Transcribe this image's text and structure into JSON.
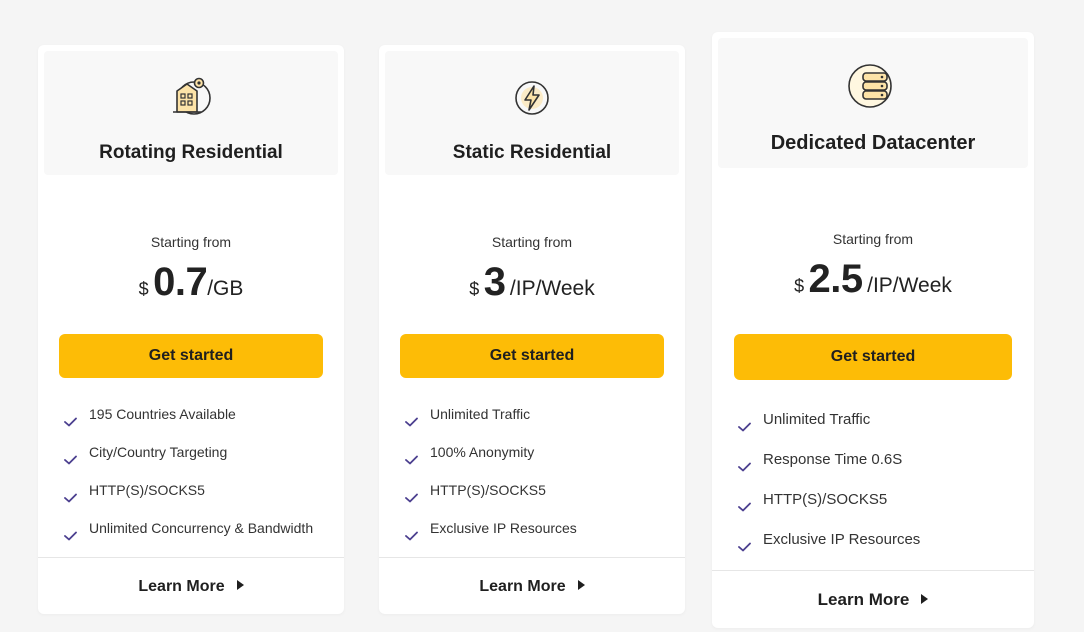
{
  "colors": {
    "accent": "#fdbc06",
    "check": "#4b3f8f",
    "icon_fill": "#fde3a7"
  },
  "cards": [
    {
      "icon": "residential-building-location-icon",
      "title": "Rotating Residential",
      "starting_label": "Starting from",
      "currency": "$",
      "price": "0.7",
      "unit": "/GB",
      "button_label": "Get started",
      "features": [
        "195 Countries Available",
        "City/Country Targeting",
        "HTTP(S)/SOCKS5",
        "Unlimited Concurrency & Bandwidth"
      ],
      "learn_more": "Learn More"
    },
    {
      "icon": "lightning-bolt-icon",
      "title": "Static Residential",
      "starting_label": "Starting from",
      "currency": "$",
      "price": "3",
      "unit": "/IP/Week",
      "button_label": "Get started",
      "features": [
        "Unlimited Traffic",
        "100% Anonymity",
        "HTTP(S)/SOCKS5",
        "Exclusive IP Resources"
      ],
      "learn_more": "Learn More"
    },
    {
      "icon": "server-stack-icon",
      "title": "Dedicated Datacenter",
      "starting_label": "Starting from",
      "currency": "$",
      "price": "2.5",
      "unit": "/IP/Week",
      "button_label": "Get started",
      "features": [
        "Unlimited Traffic",
        "Response Time 0.6S",
        "HTTP(S)/SOCKS5",
        "Exclusive IP Resources"
      ],
      "learn_more": "Learn More"
    }
  ]
}
